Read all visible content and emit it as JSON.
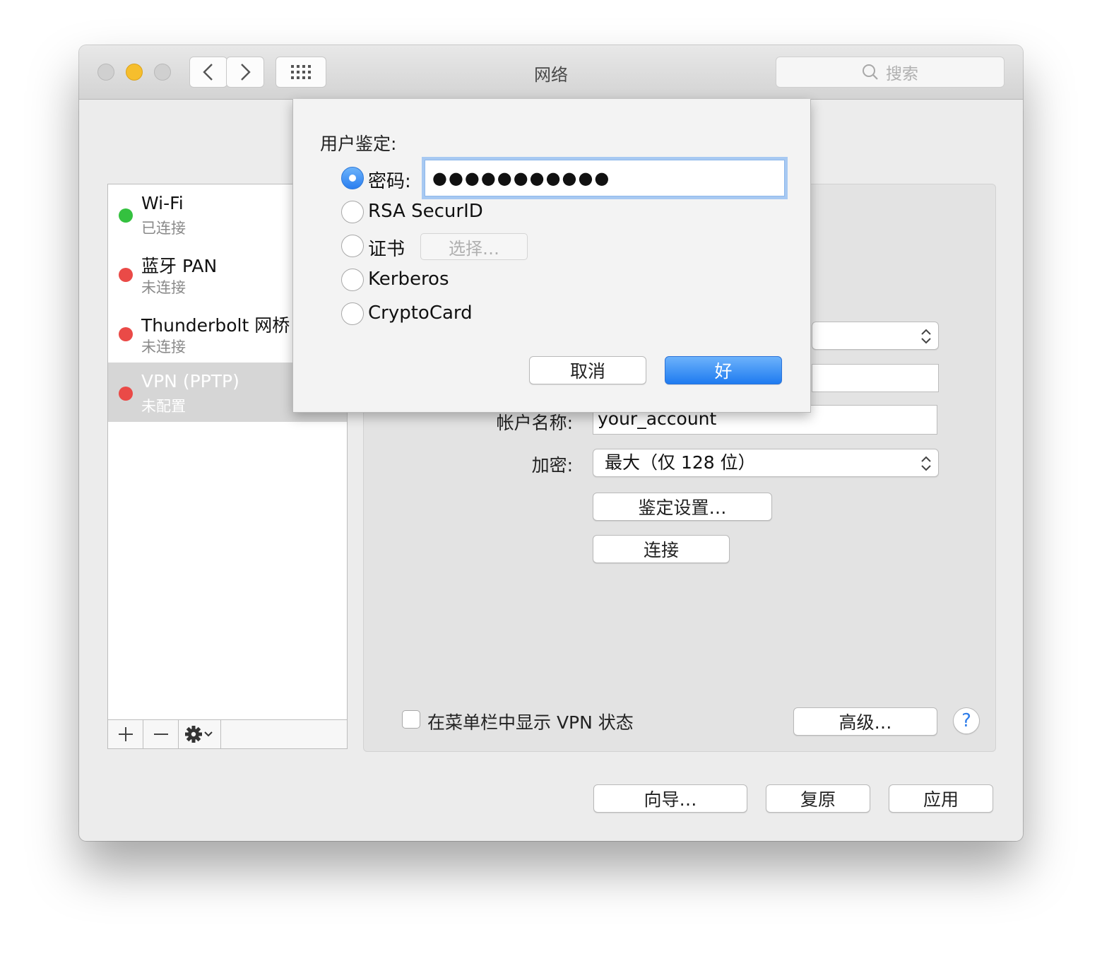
{
  "window": {
    "title": "网络"
  },
  "toolbar": {
    "search_placeholder": "搜索"
  },
  "sidebar": {
    "services": [
      {
        "name": "Wi-Fi",
        "status": "已连接",
        "dot_color": "#34c13f",
        "selected": false
      },
      {
        "name": "蓝牙 PAN",
        "status": "未连接",
        "dot_color": "#ea4a47",
        "selected": false
      },
      {
        "name": "Thunderbolt 网桥",
        "status": "未连接",
        "dot_color": "#ea4a47",
        "selected": false
      },
      {
        "name": "VPN (PPTP)",
        "status": "未配置",
        "dot_color": "#ea4a47",
        "selected": true
      }
    ]
  },
  "details": {
    "account_label": "帐户名称:",
    "account_value": "your_account",
    "encryption_label": "加密:",
    "encryption_value": "最大（仅 128 位）",
    "auth_settings_button": "鉴定设置…",
    "connect_button": "连接",
    "show_vpn_status_label": "在菜单栏中显示 VPN 状态",
    "advanced_button": "高级…",
    "help_button": "?"
  },
  "footer": {
    "assist_button": "向导…",
    "revert_button": "复原",
    "apply_button": "应用"
  },
  "auth_sheet": {
    "title": "用户鉴定:",
    "password_label": "密码:",
    "password_value": "●●●●●●●●●●●",
    "option_rsa": "RSA SecurID",
    "option_certificate": "证书",
    "choose_button": "选择…",
    "option_kerberos": "Kerberos",
    "option_cryptocard": "CryptoCard",
    "selected_option": "密码",
    "cancel_button": "取消",
    "ok_button": "好"
  },
  "colors": {
    "accent": "#2a7ef0",
    "selected_row": "#d6d6d6"
  }
}
